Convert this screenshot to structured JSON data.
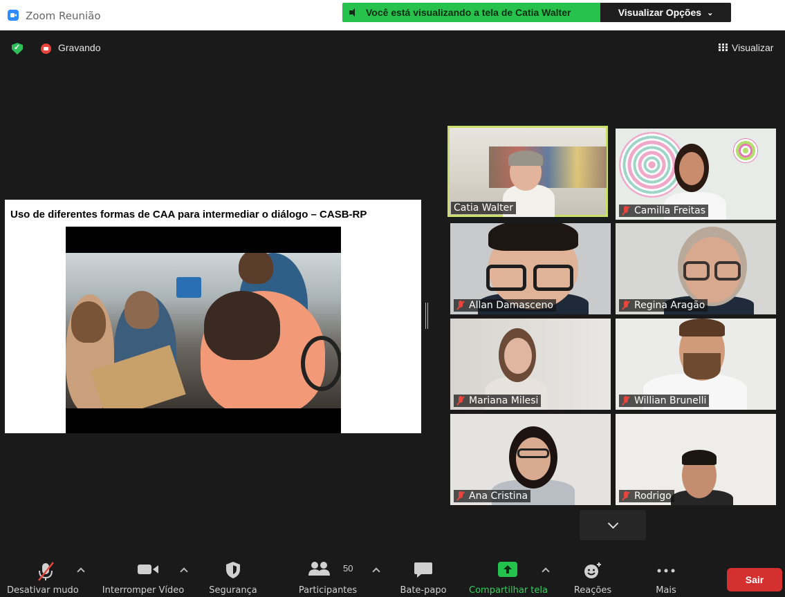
{
  "window": {
    "title": "Zoom Reunião"
  },
  "share_banner": {
    "text": "Você está visualizando a tela de Catia Walter",
    "options_label": "Visualizar Opções"
  },
  "status": {
    "recording_label": "Gravando",
    "view_label": "Visualizar"
  },
  "slide": {
    "title": "Uso de diferentes formas de CAA para intermediar o diálogo – CASB-RP"
  },
  "participants": [
    {
      "name": "Catia Walter",
      "muted": false,
      "active_speaker": true
    },
    {
      "name": "Camilla Freitas",
      "muted": true,
      "active_speaker": false
    },
    {
      "name": "Allan Damasceno",
      "muted": true,
      "active_speaker": false
    },
    {
      "name": "Regina Aragão",
      "muted": true,
      "active_speaker": false
    },
    {
      "name": "Mariana Milesi",
      "muted": true,
      "active_speaker": false
    },
    {
      "name": "Willian Brunelli",
      "muted": true,
      "active_speaker": false
    },
    {
      "name": "Ana Cristina",
      "muted": true,
      "active_speaker": false
    },
    {
      "name": "Rodrigo",
      "muted": true,
      "active_speaker": false
    }
  ],
  "toolbar": {
    "mute_label": "Desativar mudo",
    "video_label": "Interromper Vídeo",
    "security_label": "Segurança",
    "participants_label": "Participantes",
    "participants_count": "50",
    "chat_label": "Bate-papo",
    "share_label": "Compartilhar tela",
    "reactions_label": "Reações",
    "more_label": "Mais",
    "leave_label": "Sair"
  },
  "colors": {
    "share_green": "#27c24c",
    "leave_red": "#d3302f",
    "active_outline": "#c8e06a",
    "background": "#1a1a1a"
  }
}
